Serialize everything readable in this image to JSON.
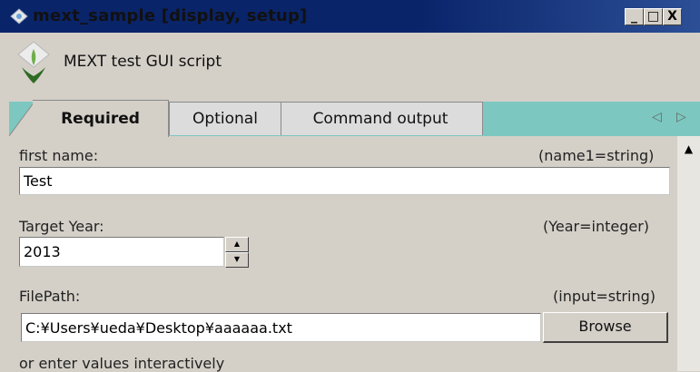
{
  "window": {
    "title": "mext_sample [display, setup]",
    "icon": "app-icon",
    "buttons": {
      "minimize": "_",
      "maximize": "□",
      "close": "X"
    }
  },
  "header": {
    "description": "MEXT test GUI script",
    "logo": "wing-logo-icon"
  },
  "tabs": [
    {
      "label": "Required",
      "active": true
    },
    {
      "label": "Optional",
      "active": false
    },
    {
      "label": "Command output",
      "active": false
    }
  ],
  "tab_nav": {
    "left": "◁",
    "right": "▷"
  },
  "fields": {
    "first_name": {
      "label": "first name:",
      "type_hint": "(name1=string)",
      "value": "Test"
    },
    "target_year": {
      "label": "Target Year:",
      "type_hint": "(Year=integer)",
      "value": "2013"
    },
    "file_path": {
      "label": "FilePath:",
      "type_hint": "(input=string)",
      "value": "C:¥Users¥ueda¥Desktop¥aaaaaa.txt",
      "browse_label": "Browse"
    }
  },
  "footer_text": "or enter values interactively",
  "colors": {
    "titlebar": "#0a246a",
    "tab_bar": "#7cc8c0",
    "window_bg": "#d4d0c8"
  }
}
